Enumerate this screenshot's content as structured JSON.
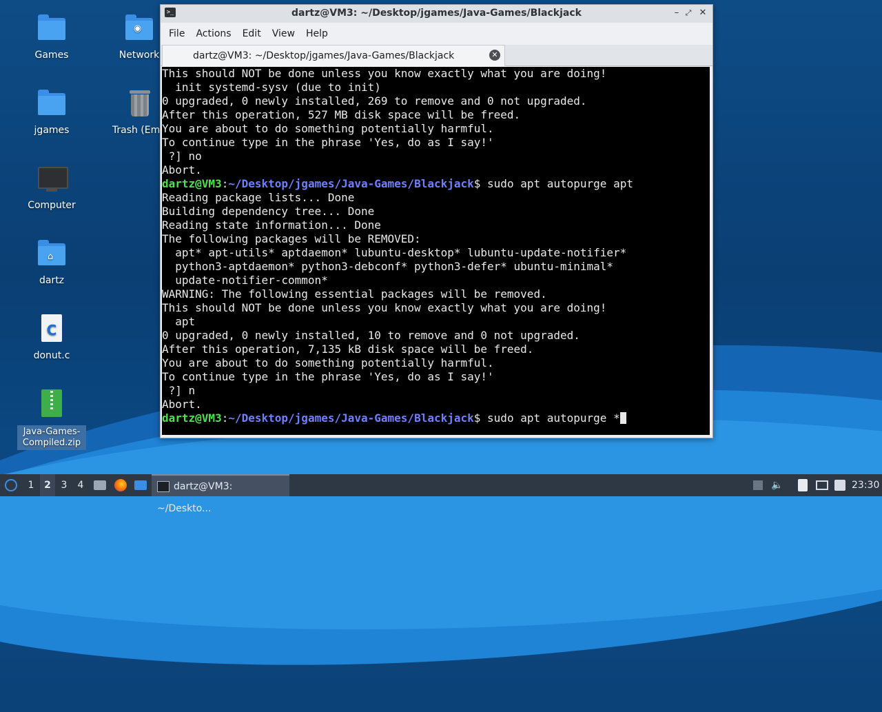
{
  "desktop": {
    "icons": [
      {
        "label": "Games",
        "icon": "folder-icon"
      },
      {
        "label": "Network",
        "icon": "network-icon"
      },
      {
        "label": "jgames",
        "icon": "folder-icon"
      },
      {
        "label": "Trash (Emp",
        "icon": "trash-icon"
      },
      {
        "label": "Computer",
        "icon": "computer-icon"
      },
      {
        "label": "dartz",
        "icon": "home-folder-icon"
      },
      {
        "label": "donut.c",
        "icon": "c-file-icon"
      },
      {
        "label": "Java-Games-Compiled.zip",
        "icon": "zip-file-icon"
      }
    ]
  },
  "window": {
    "title": "dartz@VM3: ~/Desktop/jgames/Java-Games/Blackjack",
    "menu": [
      "File",
      "Actions",
      "Edit",
      "View",
      "Help"
    ],
    "tab_label": "dartz@VM3: ~/Desktop/jgames/Java-Games/Blackjack"
  },
  "terminal": {
    "lines": [
      "This should NOT be done unless you know exactly what you are doing!",
      "  init systemd-sysv (due to init)",
      "0 upgraded, 0 newly installed, 269 to remove and 0 not upgraded.",
      "After this operation, 527 MB disk space will be freed.",
      "You are about to do something potentially harmful.",
      "To continue type in the phrase 'Yes, do as I say!'",
      " ?] no",
      "Abort.",
      "",
      "Reading package lists... Done",
      "Building dependency tree... Done",
      "Reading state information... Done",
      "The following packages will be REMOVED:",
      "  apt* apt-utils* aptdaemon* lubuntu-desktop* lubuntu-update-notifier*",
      "  python3-aptdaemon* python3-debconf* python3-defer* ubuntu-minimal*",
      "  update-notifier-common*",
      "WARNING: The following essential packages will be removed.",
      "This should NOT be done unless you know exactly what you are doing!",
      "  apt",
      "0 upgraded, 0 newly installed, 10 to remove and 0 not upgraded.",
      "After this operation, 7,135 kB disk space will be freed.",
      "You are about to do something potentially harmful.",
      "To continue type in the phrase 'Yes, do as I say!'",
      " ?] n",
      "Abort.",
      ""
    ],
    "prompt_user": "dartz@VM3",
    "prompt_sep": ":",
    "prompt_path": "~/Desktop/jgames/Java-Games/Blackjack",
    "prompt_dollar": "$",
    "cmd1": " sudo apt autopurge apt",
    "cmd2": " sudo apt autopurge *"
  },
  "taskbar": {
    "workspaces": [
      "1",
      "2",
      "3",
      "4"
    ],
    "active_workspace": "2",
    "task_label": "dartz@VM3: ~/Deskto...",
    "clock": "23:30"
  }
}
